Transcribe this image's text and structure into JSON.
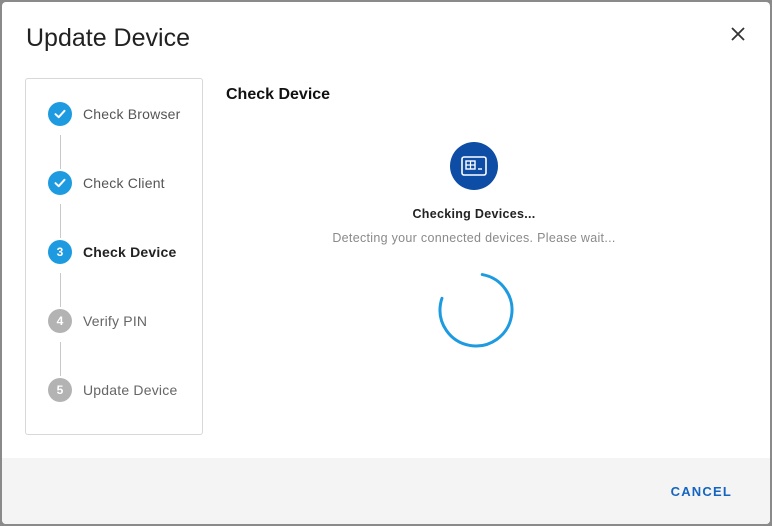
{
  "dialog": {
    "title": "Update Device",
    "close_icon": "close-icon"
  },
  "steps": [
    {
      "label": "Check Browser",
      "state": "done",
      "marker": "check-icon"
    },
    {
      "label": "Check Client",
      "state": "done",
      "marker": "check-icon"
    },
    {
      "label": "Check Device",
      "state": "active",
      "number": "3"
    },
    {
      "label": "Verify PIN",
      "state": "pending",
      "number": "4"
    },
    {
      "label": "Update Device",
      "state": "pending",
      "number": "5"
    }
  ],
  "main": {
    "section_title": "Check Device",
    "icon": "device-card-icon",
    "status_title": "Checking Devices...",
    "status_message": "Detecting your connected devices. Please wait..."
  },
  "footer": {
    "cancel_label": "CANCEL"
  },
  "colors": {
    "step_done": "#1e9be0",
    "step_pending": "#b3b3b3",
    "icon_bg": "#0d4da6",
    "spinner": "#1e9be0",
    "accent_text": "#1565c0"
  }
}
